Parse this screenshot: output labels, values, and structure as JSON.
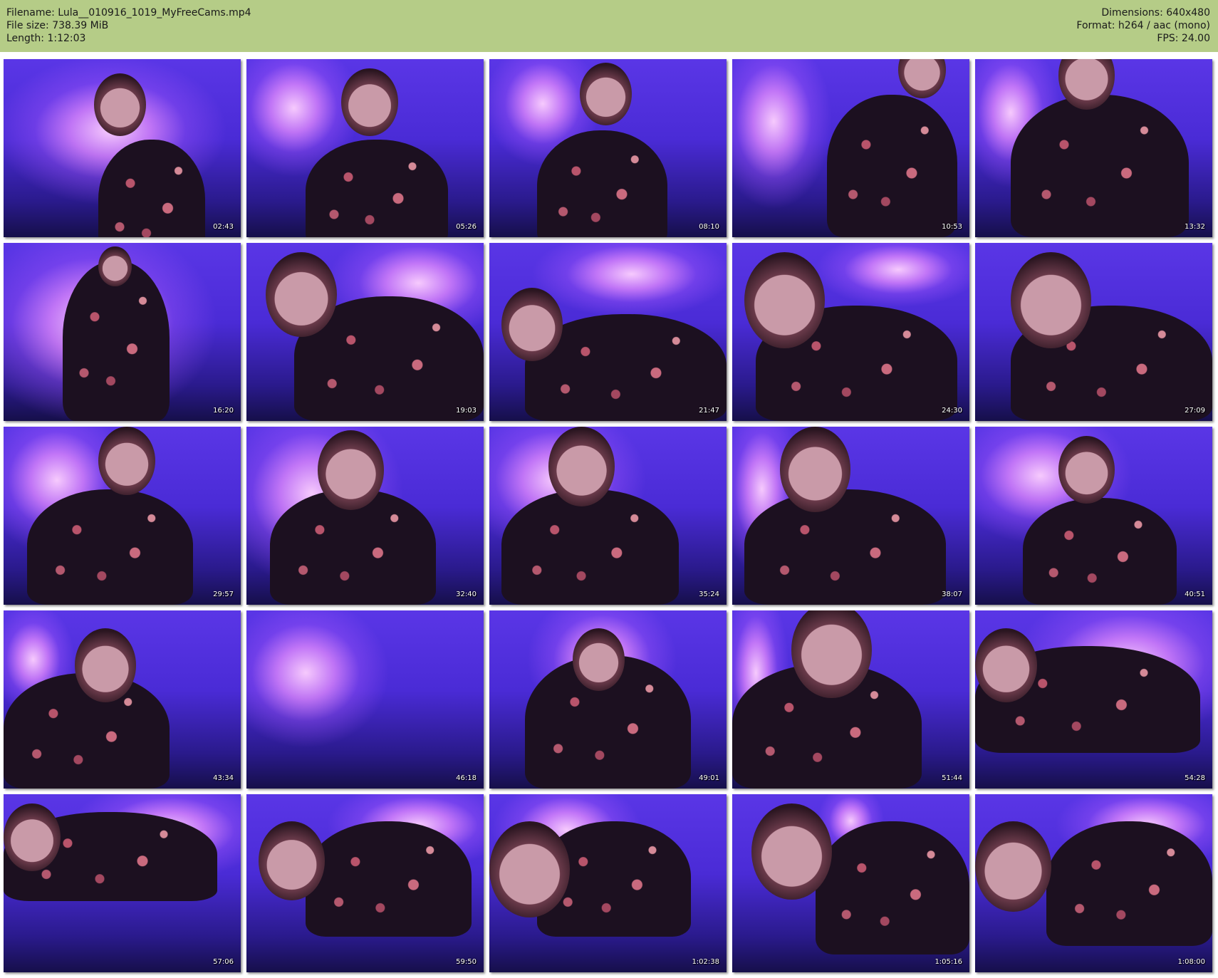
{
  "header": {
    "filename_line": "Filename: Lula__010916_1019_MyFreeCams.mp4",
    "filesize_line": "File size: 738.39 MiB",
    "length_line": "Length: 1:12:03",
    "dimensions_line": "Dimensions: 640x480",
    "format_line": "Format: h264 / aac (mono)",
    "fps_line": "FPS: 24.00"
  },
  "colors": {
    "header_bg": "#b5cc87",
    "thumb_bg": "#4a2bd6"
  },
  "thumbnails": [
    {
      "timestamp": "02:43"
    },
    {
      "timestamp": "05:26"
    },
    {
      "timestamp": "08:10"
    },
    {
      "timestamp": "10:53"
    },
    {
      "timestamp": "13:32"
    },
    {
      "timestamp": "16:20"
    },
    {
      "timestamp": "19:03"
    },
    {
      "timestamp": "21:47"
    },
    {
      "timestamp": "24:30"
    },
    {
      "timestamp": "27:09"
    },
    {
      "timestamp": "29:57"
    },
    {
      "timestamp": "32:40"
    },
    {
      "timestamp": "35:24"
    },
    {
      "timestamp": "38:07"
    },
    {
      "timestamp": "40:51"
    },
    {
      "timestamp": "43:34"
    },
    {
      "timestamp": "46:18"
    },
    {
      "timestamp": "49:01"
    },
    {
      "timestamp": "51:44"
    },
    {
      "timestamp": "54:28"
    },
    {
      "timestamp": "57:06"
    },
    {
      "timestamp": "59:50"
    },
    {
      "timestamp": "1:02:38"
    },
    {
      "timestamp": "1:05:16"
    },
    {
      "timestamp": "1:08:00"
    }
  ]
}
